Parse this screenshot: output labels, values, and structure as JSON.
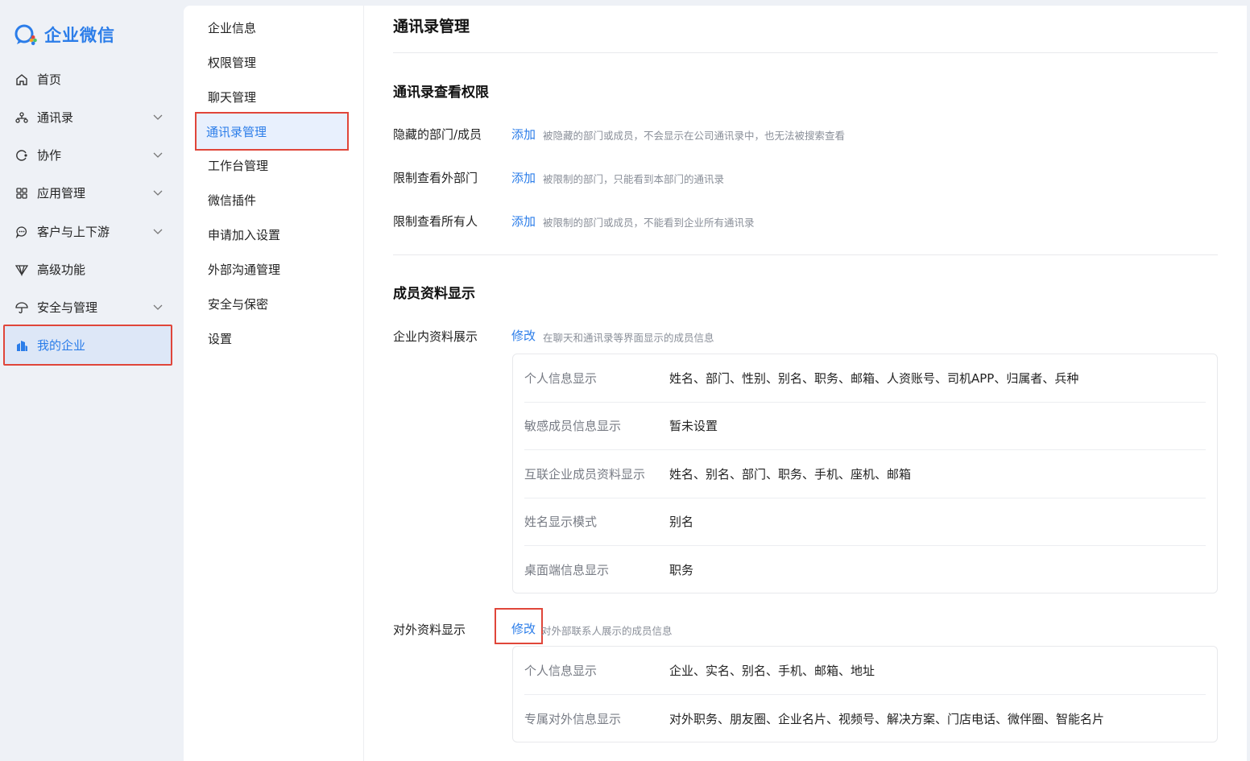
{
  "brand": {
    "name": "企业微信",
    "color": "#2b7de9"
  },
  "nav": [
    {
      "label": "首页",
      "icon": "home-icon",
      "expandable": false
    },
    {
      "label": "通讯录",
      "icon": "org-chart-icon",
      "expandable": true
    },
    {
      "label": "协作",
      "icon": "collab-icon",
      "expandable": true
    },
    {
      "label": "应用管理",
      "icon": "grid-icon",
      "expandable": true
    },
    {
      "label": "客户与上下游",
      "icon": "chat-bubble-icon",
      "expandable": true
    },
    {
      "label": "高级功能",
      "icon": "diamond-icon",
      "expandable": false
    },
    {
      "label": "安全与管理",
      "icon": "umbrella-icon",
      "expandable": true
    },
    {
      "label": "我的企业",
      "icon": "company-icon",
      "expandable": false,
      "active": true
    }
  ],
  "subnav": [
    {
      "label": "企业信息"
    },
    {
      "label": "权限管理"
    },
    {
      "label": "聊天管理"
    },
    {
      "label": "通讯录管理",
      "active": true
    },
    {
      "label": "工作台管理"
    },
    {
      "label": "微信插件"
    },
    {
      "label": "申请加入设置"
    },
    {
      "label": "外部沟通管理"
    },
    {
      "label": "安全与保密"
    },
    {
      "label": "设置"
    }
  ],
  "main": {
    "title": "通讯录管理",
    "view_permission": {
      "title": "通讯录查看权限",
      "rows": [
        {
          "label": "隐藏的部门/成员",
          "link": "添加",
          "desc": "被隐藏的部门或成员，不会显示在公司通讯录中，也无法被搜索查看"
        },
        {
          "label": "限制查看外部门",
          "link": "添加",
          "desc": "被限制的部门，只能看到本部门的通讯录"
        },
        {
          "label": "限制查看所有人",
          "link": "添加",
          "desc": "被限制的部门或成员，不能看到企业所有通讯录"
        }
      ]
    },
    "member_display": {
      "title": "成员资料显示",
      "internal": {
        "label": "企业内资料展示",
        "link": "修改",
        "desc": "在聊天和通讯录等界面显示的成员信息",
        "rows": [
          {
            "key": "个人信息显示",
            "value": "姓名、部门、性别、别名、职务、邮箱、人资账号、司机APP、归属者、兵种"
          },
          {
            "key": "敏感成员信息显示",
            "value": "暂未设置"
          },
          {
            "key": "互联企业成员资料显示",
            "value": "姓名、别名、部门、职务、手机、座机、邮箱"
          },
          {
            "key": "姓名显示模式",
            "value": "别名"
          },
          {
            "key": "桌面端信息显示",
            "value": "职务"
          }
        ]
      },
      "external": {
        "label": "对外资料显示",
        "link": "修改",
        "desc": "对外部联系人展示的成员信息",
        "rows": [
          {
            "key": "个人信息显示",
            "value": "企业、实名、别名、手机、邮箱、地址"
          },
          {
            "key": "专属对外信息显示",
            "value": "对外职务、朋友圈、企业名片、视频号、解决方案、门店电话、微伴圈、智能名片"
          }
        ]
      }
    }
  }
}
